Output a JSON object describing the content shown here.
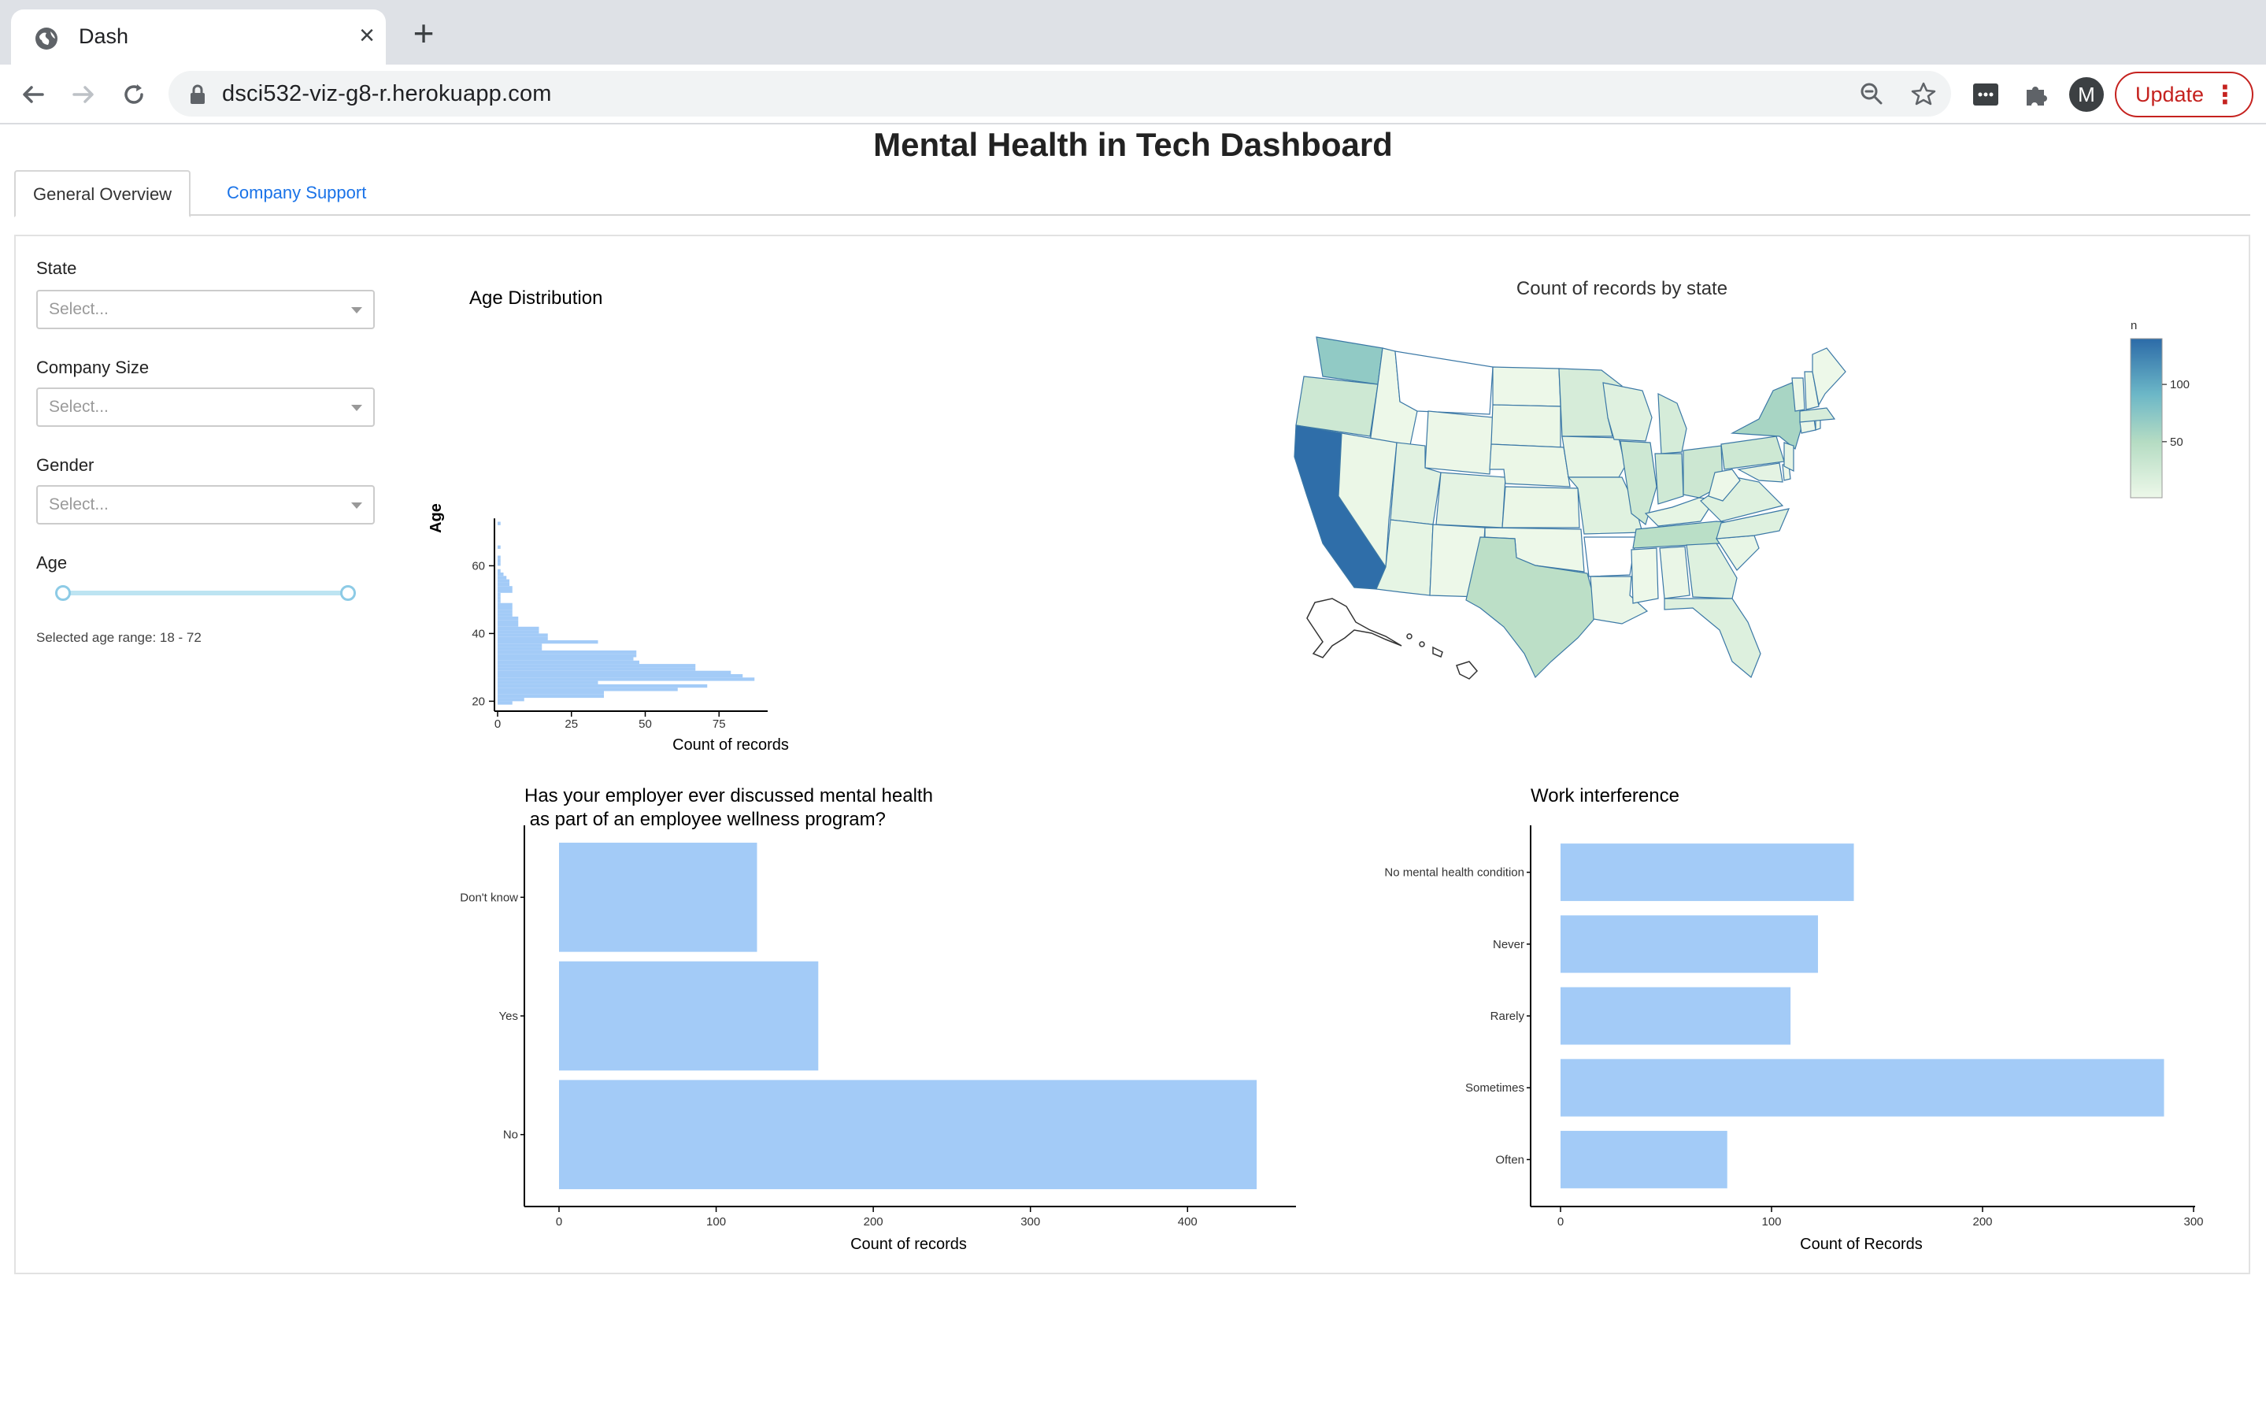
{
  "browser": {
    "tab_title": "Dash",
    "url": "dsci532-viz-g8-r.herokuapp.com",
    "avatar_letter": "M",
    "update_label": "Update"
  },
  "page": {
    "title": "Mental Health in Tech Dashboard",
    "tabs": [
      {
        "label": "General Overview",
        "active": true
      },
      {
        "label": "Company Support",
        "active": false
      }
    ]
  },
  "filters": {
    "state": {
      "label": "State",
      "placeholder": "Select..."
    },
    "company_size": {
      "label": "Company Size",
      "placeholder": "Select..."
    },
    "gender": {
      "label": "Gender",
      "placeholder": "Select..."
    },
    "age": {
      "label": "Age",
      "min": 18,
      "max": 72,
      "range_text": "Selected age range: 18 - 72"
    }
  },
  "colors": {
    "bar": "#a3cbf7",
    "accent": "#1a73e8",
    "map_high": "#2c6ba8",
    "map_low": "#edf8e9"
  },
  "chart_data": [
    {
      "id": "age",
      "type": "bar",
      "orientation": "horizontal",
      "title": "Age Distribution",
      "xlabel": "Count of records",
      "ylabel": "Age",
      "xlim": [
        0,
        92
      ],
      "ylim": [
        18,
        74
      ],
      "xticks": [
        0,
        25,
        50,
        75
      ],
      "yticks": [
        20,
        40,
        60
      ],
      "ages": [
        19,
        20,
        21,
        22,
        23,
        24,
        25,
        26,
        27,
        28,
        29,
        30,
        31,
        32,
        33,
        34,
        35,
        36,
        37,
        38,
        39,
        40,
        41,
        42,
        43,
        44,
        45,
        46,
        47,
        48,
        49,
        50,
        51,
        52,
        53,
        54,
        55,
        56,
        57,
        58,
        60,
        61,
        62,
        65,
        72
      ],
      "counts": [
        5,
        9,
        36,
        36,
        61,
        71,
        34,
        87,
        83,
        79,
        67,
        67,
        48,
        46,
        47,
        47,
        15,
        15,
        34,
        17,
        17,
        14,
        14,
        7,
        7,
        7,
        5,
        5,
        5,
        5,
        1,
        1,
        1,
        5,
        5,
        4,
        4,
        3,
        2,
        1,
        1,
        1,
        1,
        1,
        1
      ]
    },
    {
      "id": "map",
      "type": "choropleth",
      "title": "Count of records by state",
      "legend_title": "n",
      "colorbar_ticks": [
        50,
        100
      ],
      "range": [
        1,
        140
      ],
      "states": {
        "CA": 138,
        "WA": 70,
        "NY": 57,
        "TX": 44,
        "TN": 45,
        "IL": 29,
        "OH": 30,
        "OR": 29,
        "PA": 29,
        "IN": 27,
        "MI": 22,
        "MN": 21,
        "MA": 20,
        "GA": 14,
        "FL": 15,
        "WI": 13,
        "NC": 14,
        "VA": 14,
        "MD": 9,
        "NJ": 8,
        "CO": 9,
        "UT": 11,
        "MO": 12,
        "KY": 7,
        "AZ": 7,
        "IA": 6,
        "CT": 4,
        "NH": 3,
        "VT": 3,
        "ME": 1,
        "RI": 1,
        "DE": 1,
        "SC": 5,
        "AL": 4,
        "LA": 4,
        "MS": 1,
        "NV": 3,
        "NM": 1,
        "NE": 3,
        "KS": 3,
        "OK": 1,
        "SD": 3,
        "ND": 1,
        "WY": 2,
        "WV": 1,
        "ID": 1,
        "AR": 0,
        "MT": 0
      }
    },
    {
      "id": "wellness",
      "type": "bar",
      "orientation": "horizontal",
      "title_lines": [
        "Has your employer ever discussed mental health",
        " as part of an employee wellness program?"
      ],
      "xlabel": "Count of records",
      "categories": [
        "Don't know",
        "Yes",
        "No"
      ],
      "values": [
        126,
        165,
        444
      ],
      "xlim": [
        0,
        465
      ],
      "xticks": [
        0,
        100,
        200,
        300,
        400
      ]
    },
    {
      "id": "work",
      "type": "bar",
      "orientation": "horizontal",
      "title": "Work interference",
      "xlabel": "Count of Records",
      "categories": [
        "No mental health condition",
        "Never",
        "Rarely",
        "Sometimes",
        "Often"
      ],
      "values": [
        139,
        122,
        109,
        286,
        79
      ],
      "xlim": [
        0,
        300
      ],
      "xticks": [
        0,
        100,
        200,
        300
      ]
    }
  ]
}
